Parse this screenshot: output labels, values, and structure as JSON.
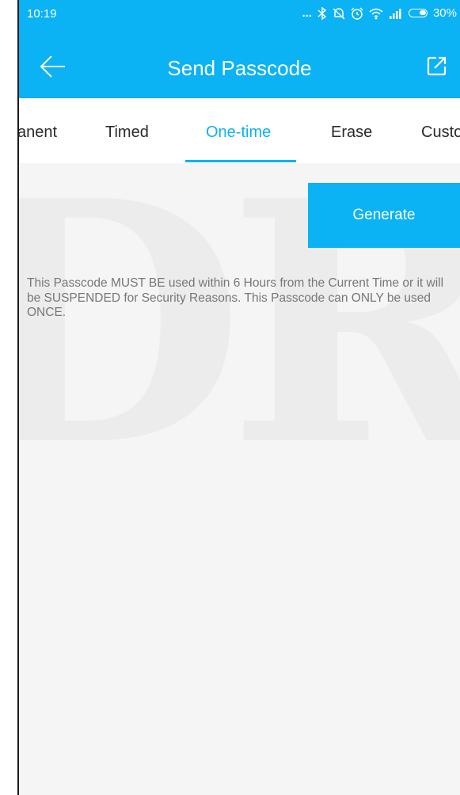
{
  "status_bar": {
    "time": "10:19",
    "dots": "...",
    "battery": "30%"
  },
  "header": {
    "title": "Send Passcode"
  },
  "tabs": [
    {
      "label": "anent"
    },
    {
      "label": "Timed"
    },
    {
      "label": "One-time",
      "active": true
    },
    {
      "label": "Erase"
    },
    {
      "label": "Custo"
    }
  ],
  "watermark": "DR",
  "generate": {
    "label": "Generate"
  },
  "notice": "This Passcode MUST BE used within 6 Hours from the Current Time or it will be SUSPENDED for Security Reasons. This Passcode can ONLY be used ONCE.",
  "colors": {
    "accent": "#0bb2f4",
    "background": "#f5f5f5",
    "text_muted": "#777777",
    "text_dark": "#2a2a2a"
  },
  "icons": [
    "back-arrow-icon",
    "share-icon",
    "bluetooth-icon",
    "alarm-icon",
    "wifi-icon",
    "signal-icon",
    "battery-icon"
  ]
}
